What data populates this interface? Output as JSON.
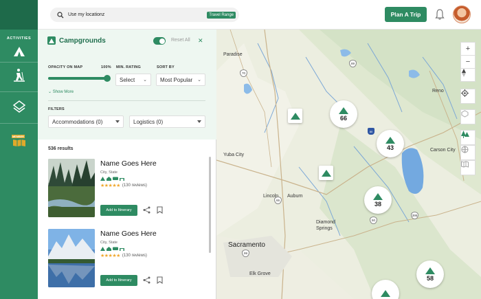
{
  "header": {
    "search_text": "Use my locationz",
    "range_chip": "Travel Range",
    "plan_button": "Plan A Trip"
  },
  "rail": {
    "activities_label": "ACTIVITIES",
    "member_label": "MEMBER"
  },
  "panel": {
    "title": "Campgrounds",
    "reset_label": "Reset All",
    "opacity_label": "OPACITY ON MAP",
    "opacity_value": "100%",
    "opacity_fraction": 1.0,
    "min_rating_label": "MIN. RATING",
    "min_rating_value": "Select",
    "sort_label": "SORT BY",
    "sort_value": "Most Popular",
    "show_more": "Show More",
    "filters_label": "FILTERS",
    "accommodations": "Accommodations (0)",
    "logistics": "Logistics (0)",
    "results": "536 results"
  },
  "cards": [
    {
      "name": "Name Goes Here",
      "location": "City, State",
      "rating": 4.5,
      "reviews": "(130 reviews)",
      "button": "Add to Itinerary"
    },
    {
      "name": "Name Goes Here",
      "location": "City, State",
      "rating": 4.5,
      "reviews": "(130 reviews)",
      "button": "Add to Itinerary"
    }
  ],
  "map": {
    "cities": [
      "Paradise",
      "Reno",
      "Carson City",
      "Yuba City",
      "Lincoln",
      "Auburn",
      "Diamond Springs",
      "Sacramento",
      "Elk Grove"
    ],
    "highways": [
      "70",
      "89",
      "80",
      "50",
      "65",
      "395",
      "99"
    ],
    "clusters": [
      66,
      43,
      38,
      58
    ],
    "controls": [
      "+",
      "−"
    ]
  },
  "colors": {
    "primary": "#2e8b62",
    "rail": "#2e8b62",
    "panel_bg": "#eef7f1",
    "star": "#f0a830"
  }
}
